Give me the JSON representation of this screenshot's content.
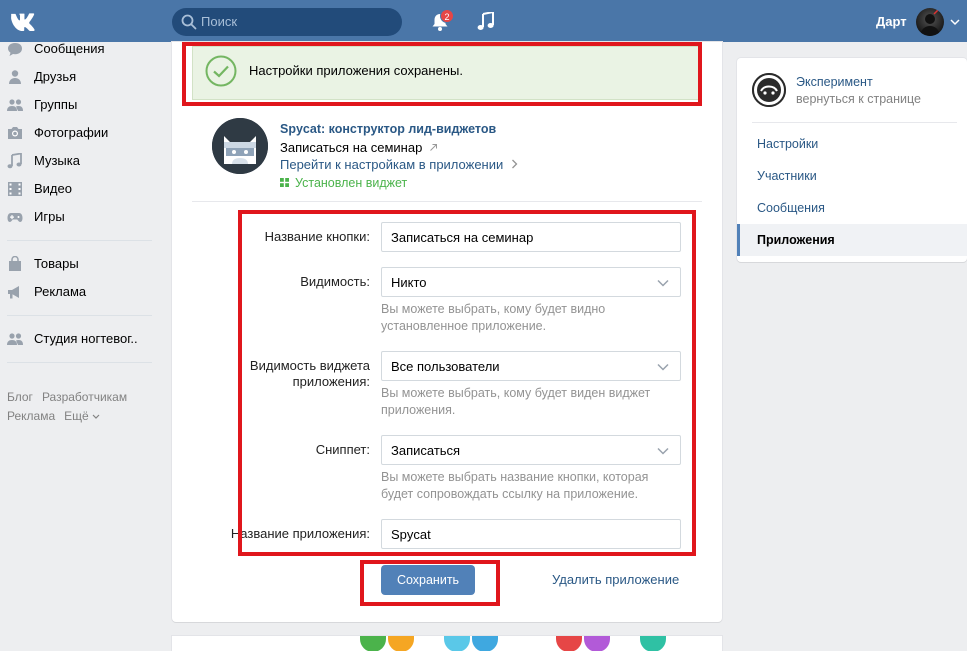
{
  "header": {
    "search_placeholder": "Поиск",
    "notifications_count": "2",
    "user_name": "Дарт"
  },
  "sidebar": {
    "items": [
      {
        "label": "Сообщения",
        "icon": "messages-icon"
      },
      {
        "label": "Друзья",
        "icon": "friends-icon"
      },
      {
        "label": "Группы",
        "icon": "groups-icon"
      },
      {
        "label": "Фотографии",
        "icon": "photos-icon"
      },
      {
        "label": "Музыка",
        "icon": "music-icon"
      },
      {
        "label": "Видео",
        "icon": "video-icon"
      },
      {
        "label": "Игры",
        "icon": "games-icon"
      }
    ],
    "items2": [
      {
        "label": "Товары",
        "icon": "goods-icon"
      },
      {
        "label": "Реклама",
        "icon": "ads-icon"
      }
    ],
    "items3": [
      {
        "label": "Студия ногтевог..",
        "icon": "community-icon"
      }
    ],
    "footer": {
      "blog": "Блог",
      "developers": "Разработчикам",
      "ads": "Реклама",
      "more": "Ещё"
    }
  },
  "main": {
    "success_message": "Настройки приложения сохранены.",
    "app": {
      "title": "Spycat: конструктор лид-виджетов",
      "action": "Записаться на семинар",
      "settings_link": "Перейти к настройкам в приложении",
      "status": "Установлен виджет"
    },
    "form": {
      "button_name": {
        "label": "Название кнопки:",
        "value": "Записаться на семинар"
      },
      "visibility": {
        "label": "Видимость:",
        "value": "Никто",
        "hint": "Вы можете выбрать, кому будет видно установленное приложение."
      },
      "widget_visibility": {
        "label": "Видимость виджета приложения:",
        "value": "Все пользователи",
        "hint": "Вы можете выбрать, кому будет виден виджет приложения."
      },
      "snippet": {
        "label": "Сниппет:",
        "value": "Записаться",
        "hint": "Вы можете выбрать название кнопки, которая будет сопровождать ссылку на приложение."
      },
      "app_name": {
        "label": "Название приложения:",
        "value": "Spycat"
      }
    },
    "save_label": "Сохранить",
    "delete_label": "Удалить приложение"
  },
  "right_panel": {
    "group_name": "Эксперимент",
    "back_label": "вернуться к странице",
    "menu": [
      {
        "label": "Настройки"
      },
      {
        "label": "Участники"
      },
      {
        "label": "Сообщения"
      },
      {
        "label": "Приложения"
      }
    ]
  },
  "colors": {
    "header": "#4a76a8",
    "accent": "#5181b8",
    "link": "#2a5885",
    "success": "#4bb34b",
    "highlight_box": "#e0161c"
  }
}
